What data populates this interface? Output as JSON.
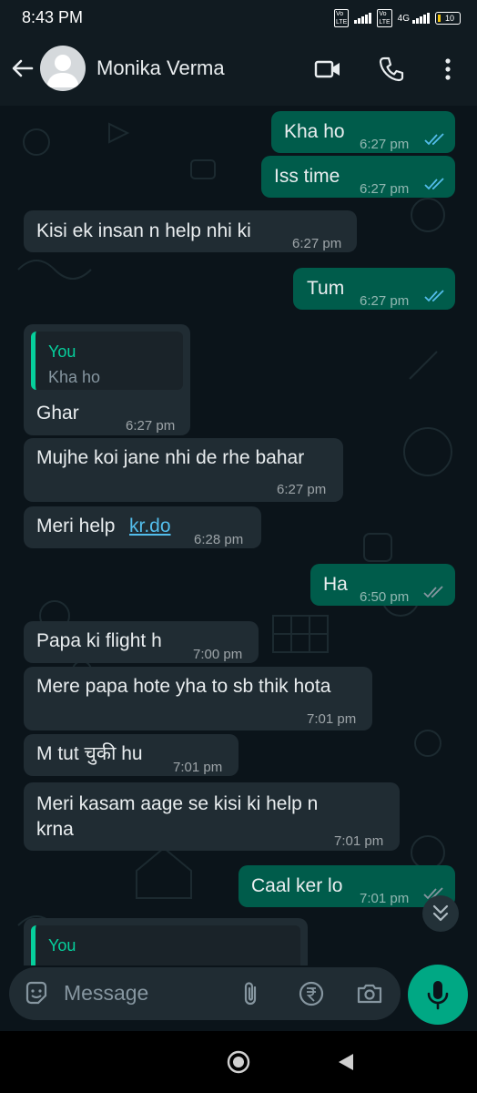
{
  "status_bar": {
    "time": "8:43 PM",
    "network": "4G",
    "battery": "10"
  },
  "header": {
    "contact_name": "Monika Verma"
  },
  "messages": [
    {
      "dir": "out",
      "text": "Kha ho",
      "time": "6:27 pm",
      "ticks": "read"
    },
    {
      "dir": "out",
      "text": "Iss time",
      "time": "6:27 pm",
      "ticks": "read"
    },
    {
      "dir": "in",
      "text": "Kisi ek insan n help nhi ki",
      "time": "6:27 pm"
    },
    {
      "dir": "out",
      "text": "Tum",
      "time": "6:27 pm",
      "ticks": "read"
    },
    {
      "dir": "in",
      "quote_name": "You",
      "quote_text": "Kha ho",
      "text": "Ghar",
      "time": "6:27 pm"
    },
    {
      "dir": "in",
      "text": "Mujhe koi jane nhi de rhe bahar",
      "time": "6:27 pm"
    },
    {
      "dir": "in",
      "text_prefix": "Meri help ",
      "link": "kr.do",
      "time": "6:28 pm"
    },
    {
      "dir": "out",
      "text": "Ha",
      "time": "6:50 pm",
      "ticks": "delivered"
    },
    {
      "dir": "in",
      "text": "Papa ki flight h",
      "time": "7:00 pm"
    },
    {
      "dir": "in",
      "text": "Mere papa hote yha to sb thik hota",
      "time": "7:01 pm"
    },
    {
      "dir": "in",
      "text": "M tut चुकी hu",
      "time": "7:01 pm"
    },
    {
      "dir": "in",
      "line1": "Meri kasam aage se kisi ki help n",
      "line2": "krna",
      "time": "7:01 pm"
    },
    {
      "dir": "out",
      "text": "Caal ker lo",
      "time": "7:01 pm",
      "ticks": "delivered"
    },
    {
      "dir": "in",
      "quote_name": "You"
    }
  ],
  "composer": {
    "placeholder": "Message"
  },
  "colors": {
    "outgoing": "#005c4b",
    "incoming": "#202c33",
    "accent": "#00a884",
    "read_ticks": "#53bdeb"
  },
  "icons": [
    "back-arrow-icon",
    "avatar-icon",
    "video-call-icon",
    "voice-call-icon",
    "more-options-icon",
    "emoji-sticker-icon",
    "attach-icon",
    "rupee-payment-icon",
    "camera-icon",
    "microphone-icon",
    "scroll-down-icon",
    "home-icon",
    "back-nav-icon"
  ]
}
